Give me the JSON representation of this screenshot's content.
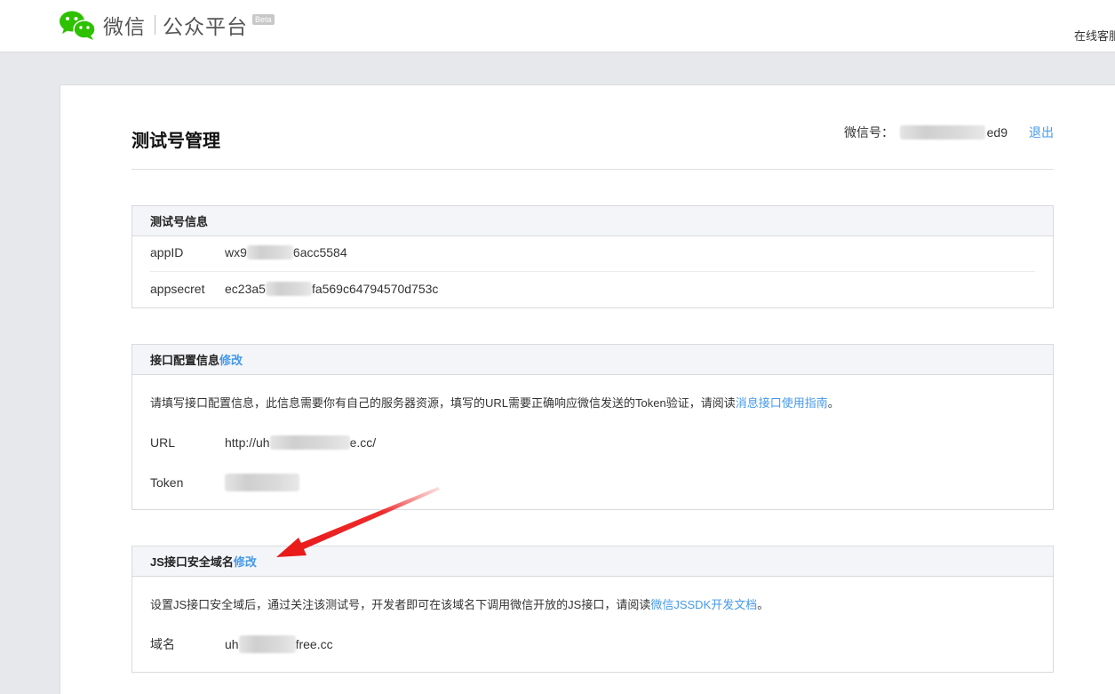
{
  "header": {
    "brand": "微信",
    "product": "公众平台",
    "beta": "Beta",
    "online_service": "在线客服"
  },
  "page": {
    "title": "测试号管理",
    "account_label": "微信号：",
    "account_value_suffix": "ed9",
    "logout": "退出"
  },
  "test_info": {
    "title": "测试号信息",
    "appid_label": "appID",
    "appid_prefix": "wx9",
    "appid_suffix": "6acc5584",
    "appsecret_label": "appsecret",
    "appsecret_prefix": "ec23a5",
    "appsecret_suffix": "fa569c64794570d753c"
  },
  "interface_config": {
    "title": "接口配置信息",
    "edit": "修改",
    "desc": "请填写接口配置信息，此信息需要你有自己的服务器资源，填写的URL需要正确响应微信发送的Token验证，请阅读",
    "desc_link": "消息接口使用指南",
    "desc_end": "。",
    "url_label": "URL",
    "url_prefix": "http://uh",
    "url_suffix": "e.cc/",
    "token_label": "Token"
  },
  "js_domain": {
    "title": "JS接口安全域名",
    "edit": "修改",
    "desc": "设置JS接口安全域后，通过关注该测试号，开发者即可在该域名下调用微信开放的JS接口，请阅读",
    "desc_link": "微信JSSDK开发文档",
    "desc_end": "。",
    "domain_label": "域名",
    "domain_prefix": "uh",
    "domain_suffix": "free.cc"
  },
  "colors": {
    "link": "#459ae9",
    "arrow": "#ee2c2c",
    "wechat_green": "#2dc100"
  }
}
